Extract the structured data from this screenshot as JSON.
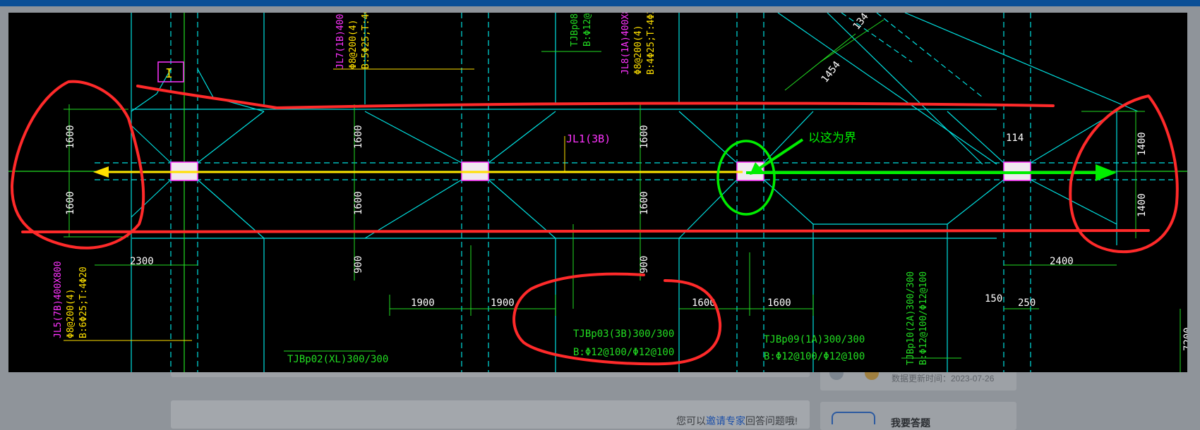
{
  "colors": {
    "header": "#0b4f96",
    "cad_background": "#000000",
    "cyan": "#00e0e0",
    "green": "#22dd22",
    "yellow": "#ffe000",
    "magenta": "#ff33ff",
    "annotation_red": "#ff2a2a",
    "annotation_green": "#00ee00"
  },
  "cad": {
    "dimensions": {
      "left_upper": "1600",
      "left_lower": "1600",
      "col2_upper": "1600",
      "col2_lower": "1600",
      "col2_bottom": "900",
      "col3_upper": "1600",
      "col3_lower": "1600",
      "col3_bottom": "900",
      "right_upper": "1400",
      "right_lower": "1400",
      "bottom_2300": "2300",
      "bottom_1900_a": "1900",
      "bottom_1900_b": "1900",
      "bottom_1600_a": "1600",
      "bottom_1600_b": "1600",
      "bottom_2400": "2400",
      "dim_150": "150",
      "dim_250": "250",
      "dim_7200": "7200",
      "dim_114": "114",
      "dim_1454": "1454",
      "dim_134": "134"
    },
    "labels": {
      "jl1": "JL1(3B)",
      "jl7_a": "JL7(1B)400",
      "jl7_b": "Φ8@200(4)",
      "jl7_c": "B:5Φ25;T:4Φ",
      "jl8_a": "JL8(1A)400X8",
      "jl8_b": "Φ8@200(4)",
      "jl8_c": "B:4Φ25;T:4Φ2",
      "tjb08_a": "TJBp08(",
      "tjb08_b": "B:Φ12@",
      "jl5_a": "JL5(7B)400X800",
      "jl5_b": "Φ8@200(4)",
      "jl5_c": "B:6Φ25;T:4Φ20",
      "tjb03_a": "TJBp03(3B)300/300",
      "tjb03_b": "B:Φ12@100/Φ12@100",
      "tjb09_a": "TJBp09(1A)300/300",
      "tjb09_b": "B:Φ12@100/Φ12@100",
      "tjb10_a": "TJBp10(2A)300/300",
      "tjb10_b": "B:Φ12@100/Φ12@100",
      "tjb02_a": "TJBp02(XL)300/300",
      "marker": "I"
    },
    "annotation_text": "以这为界"
  },
  "right_card": {
    "update_time": "数据更新时间：2023-07-26",
    "title_partial": "我要答题"
  },
  "bottom": {
    "prefix": "您可以",
    "link": "邀请专家",
    "suffix": "回答问题哦!"
  }
}
